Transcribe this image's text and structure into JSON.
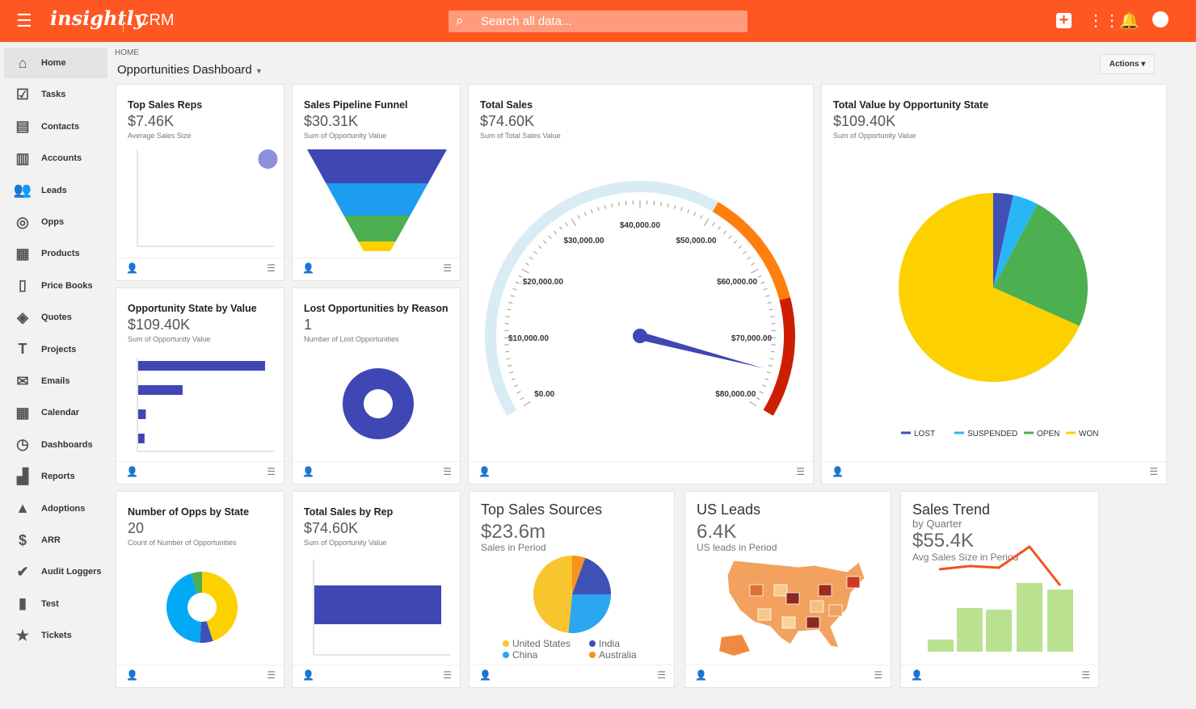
{
  "header": {
    "logo": "insightly",
    "app": "CRM",
    "search_placeholder": "Search all data...",
    "icons": [
      "plus-icon",
      "apps-grid-icon",
      "bell-icon",
      "account-icon"
    ]
  },
  "sidebar": {
    "items": [
      {
        "label": "Home",
        "icon": "home-icon",
        "g": "⌂"
      },
      {
        "label": "Tasks",
        "icon": "task-check-icon",
        "g": "☑"
      },
      {
        "label": "Contacts",
        "icon": "contacts-card-icon",
        "g": "▤"
      },
      {
        "label": "Accounts",
        "icon": "building-icon",
        "g": "▥"
      },
      {
        "label": "Leads",
        "icon": "people-icon",
        "g": "👥"
      },
      {
        "label": "Opps",
        "icon": "target-icon",
        "g": "◎"
      },
      {
        "label": "Products",
        "icon": "barcode-icon",
        "g": "▦"
      },
      {
        "label": "Price Books",
        "icon": "book-icon",
        "g": "▯"
      },
      {
        "label": "Quotes",
        "icon": "tag-icon",
        "g": "◈"
      },
      {
        "label": "Projects",
        "icon": "hammer-icon",
        "g": "T"
      },
      {
        "label": "Emails",
        "icon": "envelope-icon",
        "g": "✉"
      },
      {
        "label": "Calendar",
        "icon": "calendar-icon",
        "g": "▦"
      },
      {
        "label": "Dashboards",
        "icon": "dashboard-gauge-icon",
        "g": "◷"
      },
      {
        "label": "Reports",
        "icon": "bar-chart-icon",
        "g": "▟"
      },
      {
        "label": "Adoptions",
        "icon": "warning-icon",
        "g": "▲"
      },
      {
        "label": "ARR",
        "icon": "dollar-icon",
        "g": "$"
      },
      {
        "label": "Audit Loggers",
        "icon": "user-check-icon",
        "g": "✔"
      },
      {
        "label": "Test",
        "icon": "document-icon",
        "g": "▮"
      },
      {
        "label": "Tickets",
        "icon": "ticket-icon",
        "g": "★"
      }
    ]
  },
  "page": {
    "breadcrumb": "HOME",
    "title": "Opportunities Dashboard",
    "actions": "Actions"
  },
  "cards": [
    {
      "title": "Top Sales Reps",
      "value": "$7.46K",
      "sub": "Average Sales Size"
    },
    {
      "title": "Sales Pipeline Funnel",
      "value": "$30.31K",
      "sub": "Sum of Opportunity Value"
    },
    {
      "title": "Total Sales",
      "value": "$74.60K",
      "sub": "Sum of Total Sales Value"
    },
    {
      "title": "Total Value by Opportunity State",
      "value": "$109.40K",
      "sub": "Sum of Opportunity Value"
    },
    {
      "title": "Opportunity State by Value",
      "value": "$109.40K",
      "sub": "Sum of Opportunity Value"
    },
    {
      "title": "Lost Opportunities by Reason",
      "value": "1",
      "sub": "Number of Lost Opportunities"
    },
    {
      "title": "Number of Opps by State",
      "value": "20",
      "sub": "Count of Number of Opportunities"
    },
    {
      "title": "Total Sales by Rep",
      "value": "$74.60K",
      "sub": "Sum of Opportunity Value"
    },
    {
      "title": "Top Sales Sources",
      "value": "$23.6m",
      "sub": "Sales in Period"
    },
    {
      "title": "US Leads",
      "value": "6.4K",
      "sub": "US leads in Period"
    },
    {
      "title": "Sales Trend",
      "subtitle": "by Quarter",
      "value": "$55.4K",
      "sub": "Avg Sales Size in Period"
    }
  ],
  "chart_data": [
    {
      "type": "gauge",
      "min": 0,
      "max": 80000,
      "value": 74600,
      "ticks": [
        "$0.00",
        "$10,000.00",
        "$20,000.00",
        "$30,000.00",
        "$40,000.00",
        "$50,000.00",
        "$60,000.00",
        "$70,000.00",
        "$80,000.00"
      ],
      "bands": [
        {
          "from": 0,
          "to": 50000,
          "color": "#d9ecf5"
        },
        {
          "from": 50000,
          "to": 65000,
          "color": "#ff7f0e"
        },
        {
          "from": 65000,
          "to": 80000,
          "color": "#cc1f00"
        }
      ]
    },
    {
      "type": "pie",
      "legend": "bottom",
      "series": [
        {
          "name": "LOST",
          "value": 3.4,
          "color": "#3f51b5"
        },
        {
          "name": "SUSPENDED",
          "value": 4.4,
          "color": "#29b6f6"
        },
        {
          "name": "OPEN",
          "value": 23.9,
          "color": "#4caf50"
        },
        {
          "name": "WON",
          "value": 68.3,
          "color": "#fdd000"
        }
      ]
    },
    {
      "type": "pie",
      "legend": "bottom",
      "series": [
        {
          "name": "Australia",
          "value": 5.5,
          "color": "#f7931e"
        },
        {
          "name": "India",
          "value": 19.5,
          "color": "#3f51b5"
        },
        {
          "name": "China",
          "value": 26.5,
          "color": "#2aa7ee"
        },
        {
          "name": "United States",
          "value": 48.5,
          "color": "#f8c52f"
        }
      ]
    },
    {
      "type": "donut",
      "series": [
        {
          "value": 45,
          "color": "#fdd000"
        },
        {
          "value": 6,
          "color": "#3f51b5"
        },
        {
          "value": 44,
          "color": "#03a9f4"
        },
        {
          "value": 5,
          "color": "#4caf50"
        }
      ]
    },
    {
      "type": "donut",
      "series": [
        {
          "value": 100,
          "color": "#3f47b5"
        }
      ]
    },
    {
      "type": "bar",
      "orientation": "horizontal",
      "values": [
        100,
        35,
        6,
        5
      ],
      "color": "#3f47b5"
    },
    {
      "type": "bar",
      "orientation": "horizontal",
      "values": [
        100
      ],
      "color": "#3f47b5"
    },
    {
      "type": "scatter",
      "points": [
        [
          95,
          90
        ]
      ],
      "color": "#8c8fdc"
    },
    {
      "type": "funnel",
      "colors": [
        "#3f47b5",
        "#1e9cf0",
        "#4caf50",
        "#fdd000"
      ]
    },
    {
      "type": "bar+line",
      "bars": [
        15,
        54,
        52,
        85,
        77
      ],
      "line": [
        62,
        66,
        64,
        90,
        42
      ],
      "bar_color": "#b9e18f",
      "line_color": "#f4511e"
    }
  ]
}
